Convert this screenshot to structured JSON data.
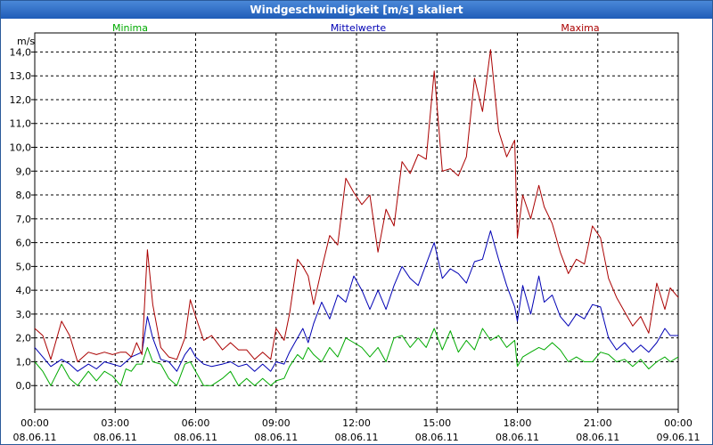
{
  "window": {
    "title": "Windgeschwindigkeit [m/s] skaliert"
  },
  "chart_data": {
    "type": "line",
    "title": "Windgeschwindigkeit [m/s] skaliert",
    "ylabel": "m/s",
    "xlabel": "",
    "ylim": [
      -1.0,
      14.8
    ],
    "xlim": [
      0,
      24
    ],
    "grid": true,
    "legend_position": "top",
    "y_ticks": [
      "0,0",
      "1,0",
      "2,0",
      "3,0",
      "4,0",
      "5,0",
      "6,0",
      "7,0",
      "8,0",
      "9,0",
      "10,0",
      "11,0",
      "12,0",
      "13,0",
      "14,0"
    ],
    "x_ticks": [
      {
        "time": "00:00",
        "date": "08.06.11"
      },
      {
        "time": "03:00",
        "date": "08.06.11"
      },
      {
        "time": "06:00",
        "date": "08.06.11"
      },
      {
        "time": "09:00",
        "date": "08.06.11"
      },
      {
        "time": "12:00",
        "date": "08.06.11"
      },
      {
        "time": "15:00",
        "date": "08.06.11"
      },
      {
        "time": "18:00",
        "date": "08.06.11"
      },
      {
        "time": "21:00",
        "date": "08.06.11"
      },
      {
        "time": "00:00",
        "date": "09.06.11"
      }
    ],
    "series": [
      {
        "name": "Minima",
        "color": "#00aa00",
        "points": [
          [
            0,
            1.0
          ],
          [
            0.3,
            0.6
          ],
          [
            0.6,
            0.0
          ],
          [
            1.0,
            0.9
          ],
          [
            1.3,
            0.3
          ],
          [
            1.6,
            0.0
          ],
          [
            2.0,
            0.6
          ],
          [
            2.3,
            0.2
          ],
          [
            2.6,
            0.6
          ],
          [
            2.9,
            0.4
          ],
          [
            3.2,
            0.0
          ],
          [
            3.4,
            0.7
          ],
          [
            3.6,
            0.6
          ],
          [
            3.8,
            0.9
          ],
          [
            4.0,
            0.9
          ],
          [
            4.2,
            1.6
          ],
          [
            4.4,
            1.0
          ],
          [
            4.7,
            0.9
          ],
          [
            5.0,
            0.3
          ],
          [
            5.3,
            0.0
          ],
          [
            5.6,
            0.9
          ],
          [
            5.8,
            1.0
          ],
          [
            6.0,
            0.6
          ],
          [
            6.3,
            0.0
          ],
          [
            6.6,
            0.0
          ],
          [
            7.0,
            0.3
          ],
          [
            7.3,
            0.6
          ],
          [
            7.6,
            0.0
          ],
          [
            7.9,
            0.3
          ],
          [
            8.2,
            0.0
          ],
          [
            8.5,
            0.3
          ],
          [
            8.8,
            0.0
          ],
          [
            9.0,
            0.2
          ],
          [
            9.3,
            0.3
          ],
          [
            9.5,
            0.8
          ],
          [
            9.8,
            1.3
          ],
          [
            10.0,
            1.1
          ],
          [
            10.2,
            1.6
          ],
          [
            10.4,
            1.3
          ],
          [
            10.7,
            1.0
          ],
          [
            11.0,
            1.6
          ],
          [
            11.3,
            1.2
          ],
          [
            11.6,
            2.0
          ],
          [
            11.9,
            1.8
          ],
          [
            12.2,
            1.6
          ],
          [
            12.5,
            1.2
          ],
          [
            12.8,
            1.6
          ],
          [
            13.1,
            1.0
          ],
          [
            13.4,
            2.0
          ],
          [
            13.7,
            2.1
          ],
          [
            14.0,
            1.6
          ],
          [
            14.3,
            2.0
          ],
          [
            14.6,
            1.6
          ],
          [
            14.9,
            2.4
          ],
          [
            15.2,
            1.5
          ],
          [
            15.5,
            2.3
          ],
          [
            15.8,
            1.4
          ],
          [
            16.1,
            1.9
          ],
          [
            16.4,
            1.5
          ],
          [
            16.7,
            2.4
          ],
          [
            17.0,
            1.9
          ],
          [
            17.3,
            2.1
          ],
          [
            17.6,
            1.6
          ],
          [
            17.9,
            1.9
          ],
          [
            18.0,
            0.8
          ],
          [
            18.2,
            1.2
          ],
          [
            18.5,
            1.4
          ],
          [
            18.8,
            1.6
          ],
          [
            19.0,
            1.5
          ],
          [
            19.3,
            1.8
          ],
          [
            19.6,
            1.5
          ],
          [
            19.9,
            1.0
          ],
          [
            20.2,
            1.2
          ],
          [
            20.5,
            1.0
          ],
          [
            20.8,
            1.0
          ],
          [
            21.1,
            1.4
          ],
          [
            21.4,
            1.3
          ],
          [
            21.7,
            1.0
          ],
          [
            22.0,
            1.1
          ],
          [
            22.3,
            0.8
          ],
          [
            22.6,
            1.1
          ],
          [
            22.9,
            0.7
          ],
          [
            23.2,
            1.0
          ],
          [
            23.5,
            1.2
          ],
          [
            23.7,
            1.0
          ],
          [
            24.0,
            1.2
          ]
        ]
      },
      {
        "name": "Mittelwerte",
        "color": "#0000b4",
        "points": [
          [
            0,
            1.6
          ],
          [
            0.3,
            1.2
          ],
          [
            0.6,
            0.8
          ],
          [
            1.0,
            1.1
          ],
          [
            1.3,
            0.9
          ],
          [
            1.6,
            0.6
          ],
          [
            2.0,
            0.9
          ],
          [
            2.3,
            0.7
          ],
          [
            2.6,
            1.0
          ],
          [
            2.9,
            0.9
          ],
          [
            3.2,
            0.8
          ],
          [
            3.4,
            1.0
          ],
          [
            3.6,
            1.2
          ],
          [
            3.8,
            1.3
          ],
          [
            4.0,
            1.4
          ],
          [
            4.2,
            2.9
          ],
          [
            4.4,
            2.0
          ],
          [
            4.7,
            1.1
          ],
          [
            5.0,
            1.0
          ],
          [
            5.3,
            0.6
          ],
          [
            5.6,
            1.3
          ],
          [
            5.8,
            1.6
          ],
          [
            6.0,
            1.2
          ],
          [
            6.3,
            0.9
          ],
          [
            6.6,
            0.8
          ],
          [
            7.0,
            0.9
          ],
          [
            7.3,
            1.0
          ],
          [
            7.6,
            0.8
          ],
          [
            7.9,
            0.9
          ],
          [
            8.2,
            0.6
          ],
          [
            8.5,
            0.9
          ],
          [
            8.8,
            0.6
          ],
          [
            9.0,
            1.0
          ],
          [
            9.3,
            0.9
          ],
          [
            9.5,
            1.4
          ],
          [
            9.8,
            2.0
          ],
          [
            10.0,
            2.4
          ],
          [
            10.2,
            1.8
          ],
          [
            10.4,
            2.6
          ],
          [
            10.7,
            3.5
          ],
          [
            11.0,
            2.8
          ],
          [
            11.3,
            3.8
          ],
          [
            11.6,
            3.5
          ],
          [
            11.9,
            4.6
          ],
          [
            12.2,
            4.0
          ],
          [
            12.5,
            3.2
          ],
          [
            12.8,
            4.0
          ],
          [
            13.1,
            3.2
          ],
          [
            13.4,
            4.2
          ],
          [
            13.7,
            5.0
          ],
          [
            14.0,
            4.5
          ],
          [
            14.3,
            4.2
          ],
          [
            14.6,
            5.1
          ],
          [
            14.9,
            6.0
          ],
          [
            15.2,
            4.5
          ],
          [
            15.5,
            4.9
          ],
          [
            15.8,
            4.7
          ],
          [
            16.1,
            4.3
          ],
          [
            16.4,
            5.2
          ],
          [
            16.7,
            5.3
          ],
          [
            17.0,
            6.5
          ],
          [
            17.3,
            5.3
          ],
          [
            17.6,
            4.2
          ],
          [
            17.9,
            3.3
          ],
          [
            18.0,
            2.7
          ],
          [
            18.2,
            4.2
          ],
          [
            18.5,
            3.0
          ],
          [
            18.8,
            4.6
          ],
          [
            19.0,
            3.5
          ],
          [
            19.3,
            3.8
          ],
          [
            19.6,
            2.9
          ],
          [
            19.9,
            2.5
          ],
          [
            20.2,
            3.0
          ],
          [
            20.5,
            2.8
          ],
          [
            20.8,
            3.4
          ],
          [
            21.1,
            3.3
          ],
          [
            21.4,
            2.0
          ],
          [
            21.7,
            1.5
          ],
          [
            22.0,
            1.8
          ],
          [
            22.3,
            1.4
          ],
          [
            22.6,
            1.7
          ],
          [
            22.9,
            1.4
          ],
          [
            23.2,
            1.8
          ],
          [
            23.5,
            2.4
          ],
          [
            23.7,
            2.1
          ],
          [
            24.0,
            2.1
          ]
        ]
      },
      {
        "name": "Maxima",
        "color": "#aa0000",
        "points": [
          [
            0,
            2.4
          ],
          [
            0.3,
            2.1
          ],
          [
            0.6,
            1.1
          ],
          [
            1.0,
            2.7
          ],
          [
            1.3,
            2.1
          ],
          [
            1.6,
            1.0
          ],
          [
            2.0,
            1.4
          ],
          [
            2.3,
            1.3
          ],
          [
            2.6,
            1.4
          ],
          [
            2.9,
            1.3
          ],
          [
            3.2,
            1.4
          ],
          [
            3.4,
            1.4
          ],
          [
            3.6,
            1.2
          ],
          [
            3.8,
            1.8
          ],
          [
            4.0,
            1.3
          ],
          [
            4.2,
            5.7
          ],
          [
            4.4,
            3.4
          ],
          [
            4.7,
            1.6
          ],
          [
            5.0,
            1.2
          ],
          [
            5.3,
            1.1
          ],
          [
            5.6,
            2.0
          ],
          [
            5.8,
            3.6
          ],
          [
            6.0,
            2.9
          ],
          [
            6.3,
            1.9
          ],
          [
            6.6,
            2.1
          ],
          [
            7.0,
            1.5
          ],
          [
            7.3,
            1.8
          ],
          [
            7.6,
            1.5
          ],
          [
            7.9,
            1.5
          ],
          [
            8.2,
            1.1
          ],
          [
            8.5,
            1.4
          ],
          [
            8.8,
            1.1
          ],
          [
            9.0,
            2.4
          ],
          [
            9.3,
            1.9
          ],
          [
            9.5,
            3.0
          ],
          [
            9.8,
            5.3
          ],
          [
            10.0,
            5.0
          ],
          [
            10.2,
            4.6
          ],
          [
            10.4,
            3.4
          ],
          [
            10.7,
            4.9
          ],
          [
            11.0,
            6.3
          ],
          [
            11.3,
            5.9
          ],
          [
            11.6,
            8.7
          ],
          [
            11.9,
            8.1
          ],
          [
            12.2,
            7.6
          ],
          [
            12.5,
            8.0
          ],
          [
            12.8,
            5.6
          ],
          [
            13.1,
            7.4
          ],
          [
            13.4,
            6.7
          ],
          [
            13.7,
            9.4
          ],
          [
            14.0,
            8.9
          ],
          [
            14.3,
            9.7
          ],
          [
            14.6,
            9.5
          ],
          [
            14.9,
            13.2
          ],
          [
            15.2,
            9.0
          ],
          [
            15.5,
            9.1
          ],
          [
            15.8,
            8.8
          ],
          [
            16.1,
            9.6
          ],
          [
            16.4,
            12.9
          ],
          [
            16.7,
            11.5
          ],
          [
            17.0,
            14.1
          ],
          [
            17.3,
            10.7
          ],
          [
            17.6,
            9.6
          ],
          [
            17.9,
            10.3
          ],
          [
            18.0,
            6.2
          ],
          [
            18.2,
            8.0
          ],
          [
            18.5,
            7.0
          ],
          [
            18.8,
            8.4
          ],
          [
            19.0,
            7.5
          ],
          [
            19.3,
            6.8
          ],
          [
            19.6,
            5.6
          ],
          [
            19.9,
            4.7
          ],
          [
            20.2,
            5.3
          ],
          [
            20.5,
            5.1
          ],
          [
            20.8,
            6.7
          ],
          [
            21.1,
            6.2
          ],
          [
            21.4,
            4.5
          ],
          [
            21.7,
            3.7
          ],
          [
            22.0,
            3.1
          ],
          [
            22.3,
            2.5
          ],
          [
            22.6,
            2.9
          ],
          [
            22.9,
            2.2
          ],
          [
            23.2,
            4.3
          ],
          [
            23.5,
            3.2
          ],
          [
            23.7,
            4.1
          ],
          [
            24.0,
            3.7
          ]
        ]
      }
    ]
  }
}
